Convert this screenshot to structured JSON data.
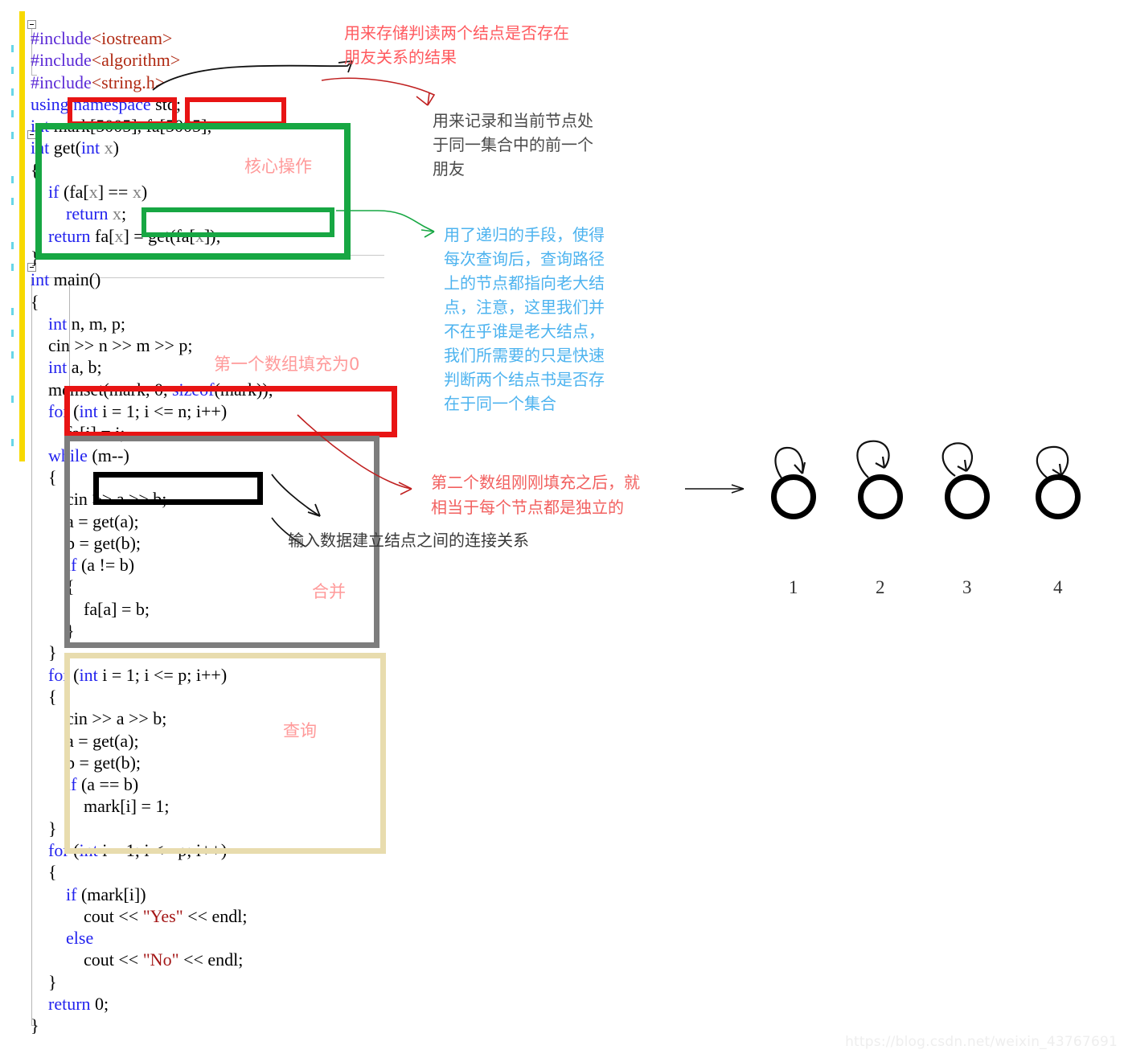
{
  "editor": {
    "code_lines": [
      "#include<iostream>",
      "#include<algorithm>",
      "#include<string.h>",
      "using namespace std;",
      "int mark[5005], fa[5005];",
      "int get(int x)",
      "{",
      "    if (fa[x] == x)",
      "        return x;",
      "    return fa[x] = get(fa[x]);",
      "}",
      "int main()",
      "{",
      "    int n, m, p;",
      "    cin >> n >> m >> p;",
      "    int a, b;",
      "    memset(mark, 0, sizeof(mark));",
      "    for (int i = 1; i <= n; i++)",
      "        fa[i] = i;",
      "    while (m--)",
      "    {",
      "        cin >> a >> b;",
      "        a = get(a);",
      "        b = get(b);",
      "        if (a != b)",
      "        {",
      "            fa[a] = b;",
      "        }",
      "    }",
      "    for (int i = 1; i <= p; i++)",
      "    {",
      "        cin >> a >> b;",
      "        a = get(a);",
      "        b = get(b);",
      "        if (a == b)",
      "            mark[i] = 1;",
      "    }",
      "    for (int i = 1; i <= p; i++)",
      "    {",
      "        if (mark[i])",
      "            cout << \"Yes\" << endl;",
      "        else",
      "            cout << \"No\" << endl;",
      "    }",
      "    return 0;",
      "}"
    ]
  },
  "annotations": {
    "mark_note": "用来存储判读两个结点是否存在\n朋友关系的结果",
    "fa_note": "用来记录和当前节点处\n于同一集合中的前一个\n朋友",
    "core_op": "核心操作",
    "recursion_note": "用了递归的手段，使得\n每次查询后，查询路径\n上的节点都指向老大结\n点，注意，这里我们并\n不在乎谁是老大结点，\n我们所需要的只是快速\n判断两个结点书是否存\n在于同一个集合",
    "memset_note": "第一个数组填充为0",
    "independent_note": "第二个数组刚刚填充之后，就\n相当于每个节点都是独立的",
    "input_note": "输入数据建立结点之间的连接关系",
    "merge_label": "合并",
    "query_label": "查询"
  },
  "diagram": {
    "node_labels": [
      "1",
      "2",
      "3",
      "4"
    ]
  },
  "watermark": {
    "text": "https://blog.csdn.net/weixin_43767691"
  },
  "colors": {
    "red_box": "#e81414",
    "green_box": "#17a743",
    "gray_box": "#7d7d7d",
    "tan_box": "#e8dcae",
    "black_box": "#000000",
    "keyword": "#2222ee",
    "preprocessor": "#5b2ad6",
    "header": "#b02a13",
    "string": "#a31515",
    "annotation_red": "#ff5a5f",
    "annotation_cyan": "#4db3ef",
    "gutter_yellow": "#f7d900"
  }
}
